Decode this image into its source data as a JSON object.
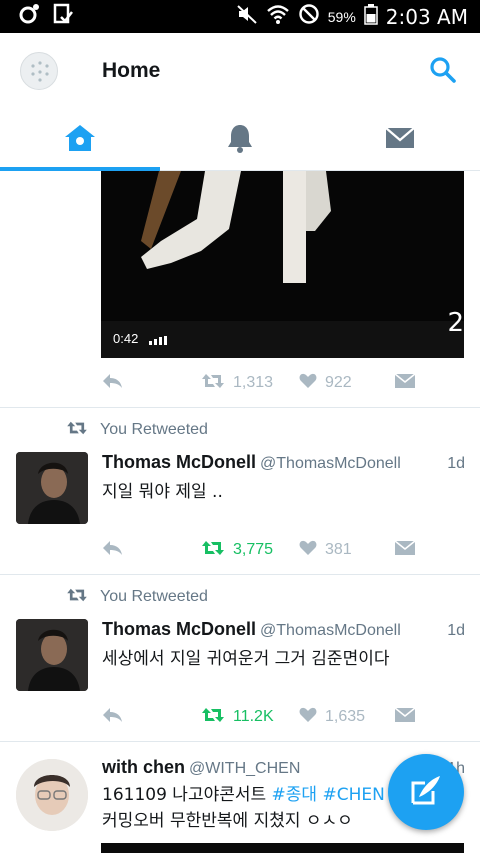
{
  "status_bar": {
    "battery_percent": "59%",
    "time": "2:03 AM",
    "icons": [
      "circle-icon",
      "clipboard-check-icon",
      "mute-icon",
      "wifi-icon",
      "do-not-disturb-icon",
      "battery-icon"
    ]
  },
  "header": {
    "title": "Home",
    "search_icon": "search-icon",
    "avatar_icon": "profile-avatar"
  },
  "tabs": [
    {
      "name": "home",
      "icon": "home-icon",
      "active": true
    },
    {
      "name": "notifications",
      "icon": "bell-icon",
      "active": false
    },
    {
      "name": "messages",
      "icon": "envelope-icon",
      "active": false
    }
  ],
  "colors": {
    "accent": "#1da1f2",
    "retweet_active": "#17bf63",
    "muted": "#aab8c2",
    "secondary_text": "#657786"
  },
  "tweets": [
    {
      "media": {
        "duration": "0:42",
        "corner_text": "2"
      },
      "actions": {
        "retweets": "1,313",
        "likes": "922",
        "retweeted": false
      }
    },
    {
      "retweeted_label": "You Retweeted",
      "name": "Thomas McDonell",
      "handle": "@ThomasMcDonell",
      "time": "1d",
      "text": "지일 뭐야 제일 ..",
      "actions": {
        "retweets": "3,775",
        "likes": "381",
        "retweeted": true
      }
    },
    {
      "retweeted_label": "You Retweeted",
      "name": "Thomas McDonell",
      "handle": "@ThomasMcDonell",
      "time": "1d",
      "text": "세상에서 지일 귀여운거 그거 김준면이다",
      "actions": {
        "retweets": "11.2K",
        "likes": "1,635",
        "retweeted": true
      }
    },
    {
      "name": "with chen",
      "handle": "@WITH_CHEN",
      "time": "1h",
      "text_line1_prefix": "161109 나고야콘서트 ",
      "hashtag1": "#종대",
      "hashtag2": "#CHEN",
      "text_line2": "커밍오버 무한반복에 지쳤지 ㅇㅅㅇ"
    }
  ],
  "fab": {
    "icon": "compose-tweet-icon"
  }
}
